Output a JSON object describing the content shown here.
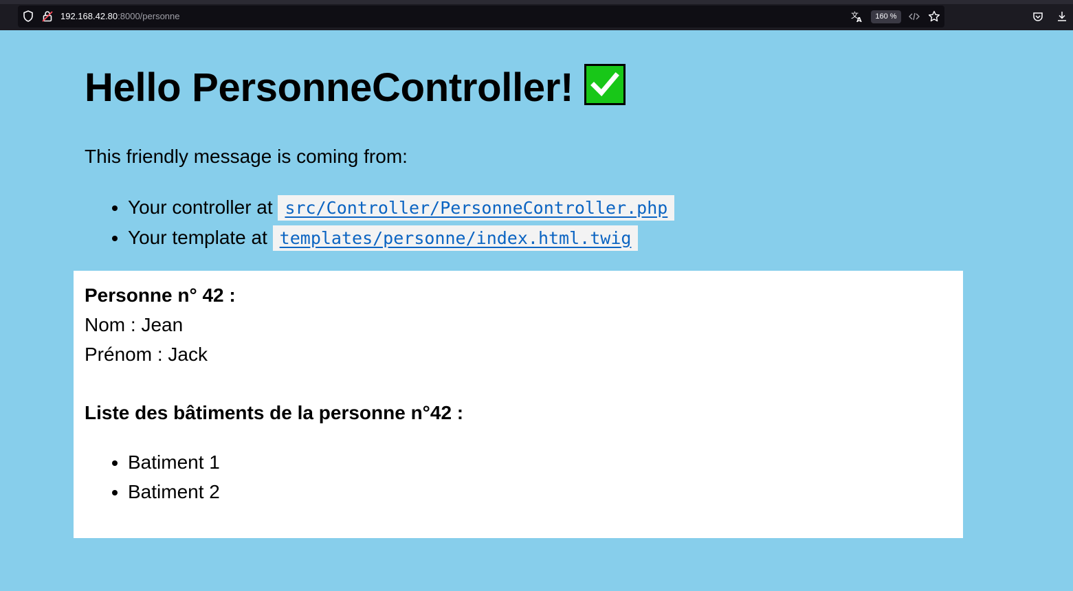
{
  "browser": {
    "url_host": "192.168.42.80",
    "url_path": ":8000/personne",
    "zoom": "160 %",
    "icons": [
      "shield-icon",
      "insecure-lock-icon",
      "translate-icon",
      "reader-view-icon",
      "bookmark-star-icon",
      "pocket-icon",
      "download-icon"
    ]
  },
  "page": {
    "title": "Hello PersonneController!",
    "title_icon": "check-mark-button-icon",
    "intro": "This friendly message is coming from:",
    "paths": [
      {
        "label": "Your controller at",
        "code": "src/Controller/PersonneController.php"
      },
      {
        "label": "Your template at",
        "code": "templates/personne/index.html.twig"
      }
    ]
  },
  "personne": {
    "heading": "Personne n° 42 :",
    "nom": "Nom : Jean",
    "prenom": "Prénom : Jack",
    "batiments_heading": "Liste des bâtiments de la personne n°42 :",
    "batiments": [
      "Batiment 1",
      "Batiment 2"
    ]
  },
  "colors": {
    "page_background": "#87ceeb",
    "card_background": "#ffffff",
    "link": "#0b64c2",
    "check_green": "#18c718"
  }
}
